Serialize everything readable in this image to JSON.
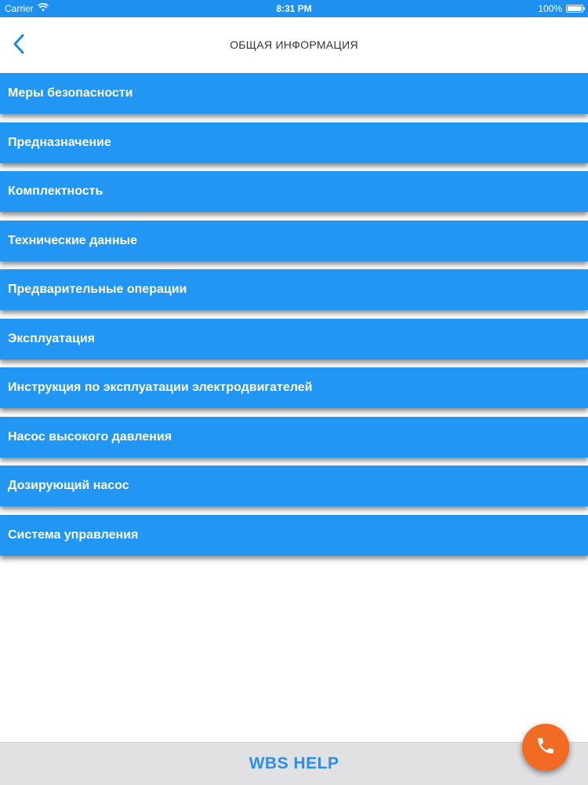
{
  "status_bar": {
    "carrier": "Carrier",
    "time": "8:31 PM",
    "battery": "100%",
    "battery_level": 1.0
  },
  "nav": {
    "title": "ОБЩАЯ ИНФОРМАЦИЯ",
    "back_icon": "chevron-left-icon"
  },
  "menu": {
    "items": [
      {
        "label": "Меры безопасности"
      },
      {
        "label": "Предназначение"
      },
      {
        "label": "Комплектность"
      },
      {
        "label": "Технические данные"
      },
      {
        "label": "Предварительные операции"
      },
      {
        "label": "Эксплуатация"
      },
      {
        "label": "Инструкция по эксплуатации электродвигателей"
      },
      {
        "label": "Насос высокого давления"
      },
      {
        "label": "Дозирующий насос"
      },
      {
        "label": "Система управления"
      }
    ]
  },
  "footer": {
    "label": "WBS HELP"
  },
  "fab": {
    "icon": "phone-icon"
  },
  "colors": {
    "accent": "#2196f3",
    "status_bar": "#1e90f0",
    "footer_text": "#2b8ee8",
    "fab": "#f26b22"
  }
}
